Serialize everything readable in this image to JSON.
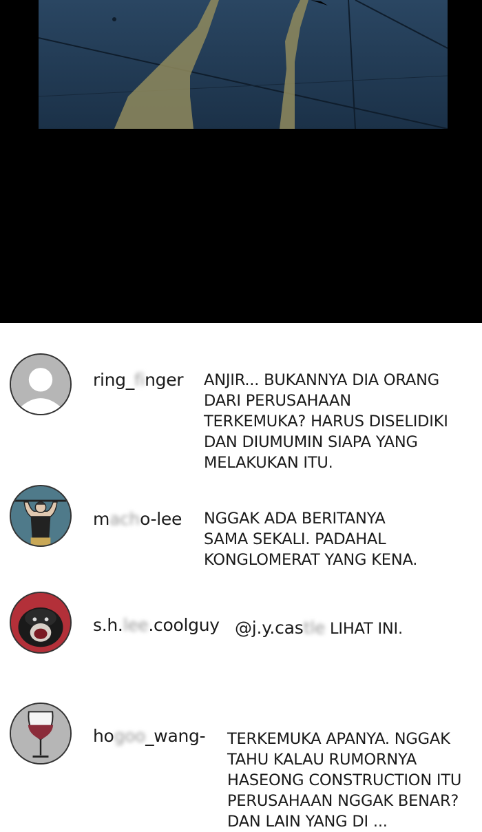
{
  "comments": [
    {
      "username": {
        "pre": "ring_",
        "blur": "fi",
        "post": "nger"
      },
      "lines": [
        "ANJIR... BUKANNYA DIA ORANG",
        "DARI PERUSAHAAN",
        "TERKEMUKA? HARUS DISELIDIKI",
        "DAN DIUMUMIN SIAPA YANG",
        "MELAKUKAN ITU."
      ],
      "avatar": "default-user-avatar"
    },
    {
      "username": {
        "pre": "m",
        "blur": "ach",
        "post": "o-lee"
      },
      "lines": [
        "NGGAK ADA BERITANYA",
        "SAMA SEKALI. PADAHAL",
        "KONGLOMERAT YANG KENA."
      ],
      "avatar": "weightlifter-avatar"
    },
    {
      "username": {
        "pre": "s.h.",
        "blur": "lee",
        "post": ".coolguy"
      },
      "mention": {
        "pre": "@j.y.cas",
        "blur": "tle"
      },
      "lines": [
        "LIHAT INI."
      ],
      "avatar": "gorilla-avatar"
    },
    {
      "username": {
        "pre": "ho",
        "blur": "goo",
        "post": "_wang-"
      },
      "lines": [
        "TERKEMUKA APANYA. NGGAK",
        "TAHU KALAU RUMORNYA",
        "HASEONG CONSTRUCTION ITU",
        "PERUSAHAAN NGGAK BENAR?",
        "DAN LAIN YANG DI ..."
      ],
      "avatar": "wine-glass-avatar"
    }
  ],
  "colors": {
    "background": "#ffffff",
    "dark_band": "#000000",
    "panel_sky": "#1d3550",
    "wine": "#8b2c3a"
  }
}
